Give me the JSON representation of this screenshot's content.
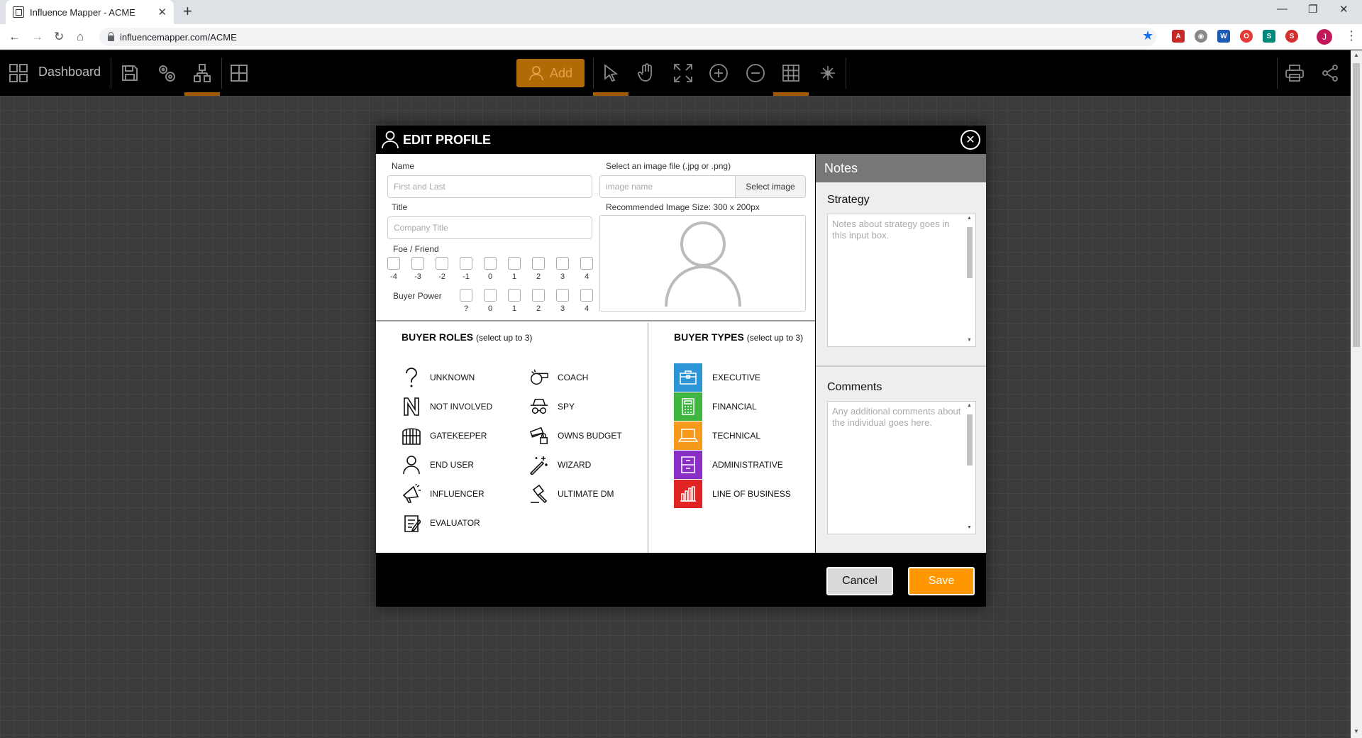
{
  "browser": {
    "tab_title": "Influence Mapper - ACME",
    "url": "influencemapper.com/ACME",
    "profile_initial": "J"
  },
  "toolbar": {
    "dashboard_label": "Dashboard",
    "add_label": "Add",
    "accent_color": "#b06b06"
  },
  "modal": {
    "title": "EDIT PROFILE",
    "name_label": "Name",
    "name_placeholder": "First and Last",
    "title_label": "Title",
    "title_placeholder": "Company Title",
    "image_label": "Select an image file (.jpg or .png)",
    "image_placeholder": "image name",
    "select_image_label": "Select image",
    "image_size_hint": "Recommended Image Size: 300 x 200px",
    "foe_friend_label": "Foe / Friend",
    "foe_friend_values": [
      "-4",
      "-3",
      "-2",
      "-1",
      "0",
      "1",
      "2",
      "3",
      "4"
    ],
    "buyer_power_label": "Buyer Power",
    "buyer_power_values": [
      "?",
      "0",
      "1",
      "2",
      "3",
      "4"
    ],
    "buyer_roles_title": "BUYER ROLES",
    "buyer_roles_sub": "(select up to 3)",
    "roles": {
      "unknown": "UNKNOWN",
      "not_involved": "NOT INVOLVED",
      "gatekeeper": "GATEKEEPER",
      "end_user": "END USER",
      "influencer": "INFLUENCER",
      "evaluator": "EVALUATOR",
      "coach": "COACH",
      "spy": "SPY",
      "owns_budget": "OWNS BUDGET",
      "wizard": "WIZARD",
      "ultimate_dm": "ULTIMATE DM"
    },
    "buyer_types_title": "BUYER TYPES",
    "buyer_types_sub": "(select up to 3)",
    "types": [
      {
        "label": "EXECUTIVE",
        "color": "#2b95d6"
      },
      {
        "label": "FINANCIAL",
        "color": "#3fb63f"
      },
      {
        "label": "TECHNICAL",
        "color": "#f59a1b"
      },
      {
        "label": "ADMINISTRATIVE",
        "color": "#8a2fc6"
      },
      {
        "label": "LINE OF BUSINESS",
        "color": "#e02424"
      }
    ],
    "notes_title": "Notes",
    "strategy_label": "Strategy",
    "strategy_placeholder": "Notes about strategy goes in this input box.",
    "comments_label": "Comments",
    "comments_placeholder": "Any additional comments about the individual goes here.",
    "cancel_label": "Cancel",
    "save_label": "Save"
  }
}
